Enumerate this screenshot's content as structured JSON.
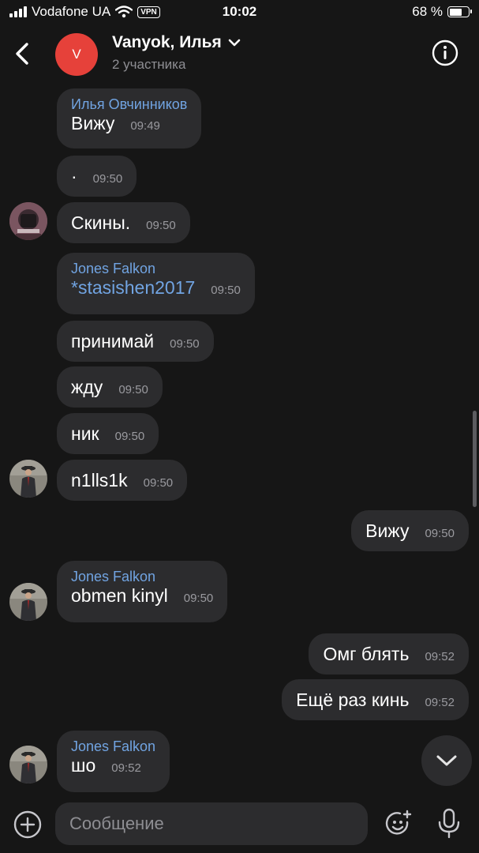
{
  "status_bar": {
    "carrier": "Vodafone UA",
    "vpn": "VPN",
    "time": "10:02",
    "battery": "68 %",
    "battery_level": 0.68
  },
  "header": {
    "avatar_letter": "V",
    "title": "Vanyok, Илья",
    "subtitle": "2 участника"
  },
  "messages": [
    {
      "sender": "Илья Овчинников",
      "text": "Вижу",
      "time": "09:49"
    },
    {
      "text": "·",
      "time": "09:50"
    },
    {
      "text": "Скины.",
      "time": "09:50"
    },
    {
      "sender": "Jones Falkon",
      "text": "*stasishen2017",
      "time": "09:50"
    },
    {
      "text": "принимай",
      "time": "09:50"
    },
    {
      "text": "жду",
      "time": "09:50"
    },
    {
      "text": "ник",
      "time": "09:50"
    },
    {
      "text": "n1lls1k",
      "time": "09:50"
    },
    {
      "text": "Вижу",
      "time": "09:50"
    },
    {
      "sender": "Jones Falkon",
      "text": "obmen kinyl",
      "time": "09:50"
    },
    {
      "text": "Омг блять",
      "time": "09:52"
    },
    {
      "text": "Ещё раз кинь",
      "time": "09:52"
    },
    {
      "sender": "Jones Falkon",
      "text": "шо",
      "time": "09:52"
    }
  ],
  "input": {
    "placeholder": "Сообщение"
  },
  "icons": {
    "back": "chevron-left-icon",
    "title_dropdown": "chevron-down-icon",
    "info": "info-icon",
    "scroll_down": "chevron-down-icon",
    "attach": "plus-circle-icon",
    "sticker": "sticker-smile-icon",
    "mic": "microphone-icon"
  },
  "colors": {
    "background": "#161616",
    "bubble": "#2c2c2e",
    "accent": "#71a4e2",
    "avatar": "#e6413a",
    "muted": "#8e8e93"
  }
}
